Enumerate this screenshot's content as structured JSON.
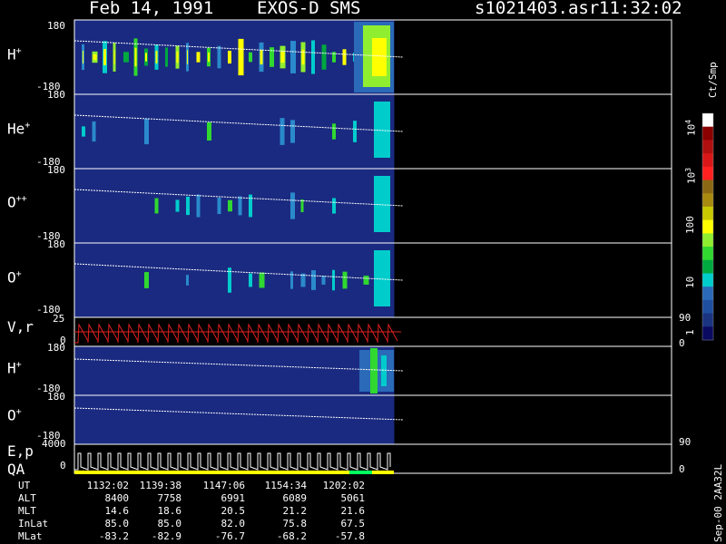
{
  "header": {
    "date": "Feb 14, 1991",
    "mission": "EXOS-D SMS",
    "file": "s1021403.asr",
    "time": "11:32:02"
  },
  "panels": [
    {
      "id": "h_plus",
      "label_main": "H",
      "label_sup": "+",
      "tick_top": "180",
      "tick_bottom": "-180"
    },
    {
      "id": "he_plus",
      "label_main": "He",
      "label_sup": "+",
      "tick_top": "180",
      "tick_bottom": "-180"
    },
    {
      "id": "o_plus_plus",
      "label_main": "O",
      "label_sup": "++",
      "tick_top": "180",
      "tick_bottom": "-180"
    },
    {
      "id": "o_plus",
      "label_main": "O",
      "label_sup": "+",
      "tick_top": "180",
      "tick_bottom": "-180"
    },
    {
      "id": "v_r",
      "label_main": "V,r",
      "tick_top": "25",
      "tick_bottom": "0",
      "right_top": "90",
      "right_bottom": "0"
    },
    {
      "id": "h_plus_2",
      "label_main": "H",
      "label_sup": "+",
      "tick_top": "180",
      "tick_bottom": "-180"
    },
    {
      "id": "o_plus_2",
      "label_main": "O",
      "label_sup": "+",
      "tick_top": "180",
      "tick_bottom": "-180"
    },
    {
      "id": "e_p_qa",
      "label_main": "E,p",
      "label_qa": "QA",
      "tick_top": "4000",
      "tick_bottom": "0",
      "right_top": "90",
      "right_bottom": "0"
    }
  ],
  "colorbar": {
    "title": "Ct/Smp",
    "ticks": [
      {
        "main": "10",
        "sup": "4"
      },
      {
        "main": "10",
        "sup": "3"
      },
      {
        "main": "100",
        "sup": ""
      },
      {
        "main": "10",
        "sup": ""
      },
      {
        "main": "1",
        "sup": ""
      }
    ],
    "colors": [
      "#ffffff",
      "#8b0000",
      "#b01010",
      "#d81818",
      "#ff2020",
      "#8b6914",
      "#a88a10",
      "#c8c800",
      "#ffff00",
      "#90ee30",
      "#30d830",
      "#00a840",
      "#00cccc",
      "#2a6ab8",
      "#1f4fa0",
      "#1a3480",
      "#0a0a60"
    ]
  },
  "time_table": {
    "labels": [
      "UT",
      "ALT",
      "MLT",
      "InLat",
      "MLat"
    ],
    "columns": [
      {
        "UT": "1132:02",
        "ALT": "8400",
        "MLT": "14.6",
        "InLat": "85.0",
        "MLat": "-83.2"
      },
      {
        "UT": "1139:38",
        "ALT": "7758",
        "MLT": "18.6",
        "InLat": "85.0",
        "MLat": "-82.9"
      },
      {
        "UT": "1147:06",
        "ALT": "6991",
        "MLT": "20.5",
        "InLat": "82.0",
        "MLat": "-76.7"
      },
      {
        "UT": "1154:34",
        "ALT": "6089",
        "MLT": "21.2",
        "InLat": "75.8",
        "MLat": "-68.2"
      },
      {
        "UT": "1202:02",
        "ALT": "5061",
        "MLT": "21.6",
        "InLat": "67.5",
        "MLat": "-57.8"
      }
    ]
  },
  "footer_vertical": "Sep-00  2AA32L",
  "colors": {
    "data_bg": "#1a2a80",
    "velocity": "#e02020",
    "qa_yellow": "#ffff00",
    "qa_green": "#00ff60"
  }
}
